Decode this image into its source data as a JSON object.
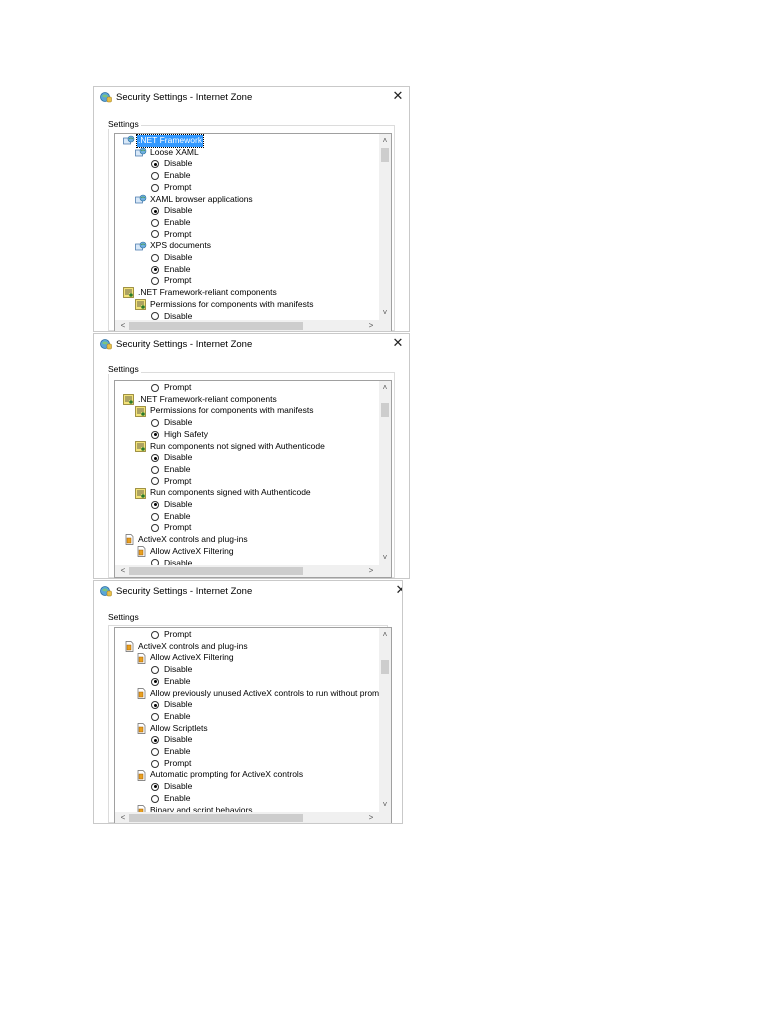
{
  "dialogs": [
    {
      "title": "Security Settings - Internet Zone",
      "settings_label": "Settings",
      "rows": [
        {
          "type": "category",
          "indent": 0,
          "icon": "net-framework-icon",
          "label": ".NET Framework",
          "selected": true
        },
        {
          "type": "category",
          "indent": 1,
          "icon": "net-framework-icon",
          "label": "Loose XAML"
        },
        {
          "type": "radio",
          "indent": 2,
          "label": "Disable",
          "checked": true
        },
        {
          "type": "radio",
          "indent": 2,
          "label": "Enable",
          "checked": false
        },
        {
          "type": "radio",
          "indent": 2,
          "label": "Prompt",
          "checked": false
        },
        {
          "type": "category",
          "indent": 1,
          "icon": "net-framework-icon",
          "label": "XAML browser applications"
        },
        {
          "type": "radio",
          "indent": 2,
          "label": "Disable",
          "checked": true
        },
        {
          "type": "radio",
          "indent": 2,
          "label": "Enable",
          "checked": false
        },
        {
          "type": "radio",
          "indent": 2,
          "label": "Prompt",
          "checked": false
        },
        {
          "type": "category",
          "indent": 1,
          "icon": "net-framework-icon",
          "label": "XPS documents"
        },
        {
          "type": "radio",
          "indent": 2,
          "label": "Disable",
          "checked": false
        },
        {
          "type": "radio",
          "indent": 2,
          "label": "Enable",
          "checked": true
        },
        {
          "type": "radio",
          "indent": 2,
          "label": "Prompt",
          "checked": false
        },
        {
          "type": "category",
          "indent": 0,
          "icon": "certificate-icon",
          "label": ".NET Framework-reliant components"
        },
        {
          "type": "category",
          "indent": 1,
          "icon": "certificate-icon",
          "label": "Permissions for components with manifests"
        },
        {
          "type": "radio",
          "indent": 2,
          "label": "Disable",
          "checked": false
        }
      ]
    },
    {
      "title": "Security Settings - Internet Zone",
      "settings_label": "Settings",
      "rows": [
        {
          "type": "radio",
          "indent": 2,
          "label": "Prompt",
          "checked": false
        },
        {
          "type": "category",
          "indent": 0,
          "icon": "certificate-icon",
          "label": ".NET Framework-reliant components"
        },
        {
          "type": "category",
          "indent": 1,
          "icon": "certificate-icon",
          "label": "Permissions for components with manifests"
        },
        {
          "type": "radio",
          "indent": 2,
          "label": "Disable",
          "checked": false
        },
        {
          "type": "radio",
          "indent": 2,
          "label": "High Safety",
          "checked": true
        },
        {
          "type": "category",
          "indent": 1,
          "icon": "certificate-icon",
          "label": "Run components not signed with Authenticode"
        },
        {
          "type": "radio",
          "indent": 2,
          "label": "Disable",
          "checked": true
        },
        {
          "type": "radio",
          "indent": 2,
          "label": "Enable",
          "checked": false
        },
        {
          "type": "radio",
          "indent": 2,
          "label": "Prompt",
          "checked": false
        },
        {
          "type": "category",
          "indent": 1,
          "icon": "certificate-icon",
          "label": "Run components signed with Authenticode"
        },
        {
          "type": "radio",
          "indent": 2,
          "label": "Disable",
          "checked": true
        },
        {
          "type": "radio",
          "indent": 2,
          "label": "Enable",
          "checked": false
        },
        {
          "type": "radio",
          "indent": 2,
          "label": "Prompt",
          "checked": false
        },
        {
          "type": "category",
          "indent": 0,
          "icon": "activex-icon",
          "label": "ActiveX controls and plug-ins"
        },
        {
          "type": "category",
          "indent": 1,
          "icon": "activex-icon",
          "label": "Allow ActiveX Filtering"
        },
        {
          "type": "radio",
          "indent": 2,
          "label": "Disable",
          "checked": false
        }
      ]
    },
    {
      "title": "Security Settings - Internet Zone",
      "settings_label": "Settings",
      "rows": [
        {
          "type": "radio",
          "indent": 2,
          "label": "Prompt",
          "checked": false
        },
        {
          "type": "category",
          "indent": 0,
          "icon": "activex-icon",
          "label": "ActiveX controls and plug-ins"
        },
        {
          "type": "category",
          "indent": 1,
          "icon": "activex-icon",
          "label": "Allow ActiveX Filtering"
        },
        {
          "type": "radio",
          "indent": 2,
          "label": "Disable",
          "checked": false
        },
        {
          "type": "radio",
          "indent": 2,
          "label": "Enable",
          "checked": true
        },
        {
          "type": "category",
          "indent": 1,
          "icon": "activex-icon",
          "label": "Allow previously unused ActiveX controls to run without prom"
        },
        {
          "type": "radio",
          "indent": 2,
          "label": "Disable",
          "checked": true
        },
        {
          "type": "radio",
          "indent": 2,
          "label": "Enable",
          "checked": false
        },
        {
          "type": "category",
          "indent": 1,
          "icon": "activex-icon",
          "label": "Allow Scriptlets"
        },
        {
          "type": "radio",
          "indent": 2,
          "label": "Disable",
          "checked": true
        },
        {
          "type": "radio",
          "indent": 2,
          "label": "Enable",
          "checked": false
        },
        {
          "type": "radio",
          "indent": 2,
          "label": "Prompt",
          "checked": false
        },
        {
          "type": "category",
          "indent": 1,
          "icon": "activex-icon",
          "label": "Automatic prompting for ActiveX controls"
        },
        {
          "type": "radio",
          "indent": 2,
          "label": "Disable",
          "checked": true
        },
        {
          "type": "radio",
          "indent": 2,
          "label": "Enable",
          "checked": false
        },
        {
          "type": "category",
          "indent": 1,
          "icon": "activex-icon",
          "label": "Binary and script behaviors"
        }
      ]
    }
  ],
  "scroll_arrows": {
    "up": "˄",
    "down": "˅",
    "left": "<",
    "right": ">"
  },
  "close_glyph": "✕",
  "colors": {
    "selection": "#3399ff",
    "scrollbar_track": "#f0f0f0",
    "scrollbar_thumb": "#cdcdcd"
  }
}
